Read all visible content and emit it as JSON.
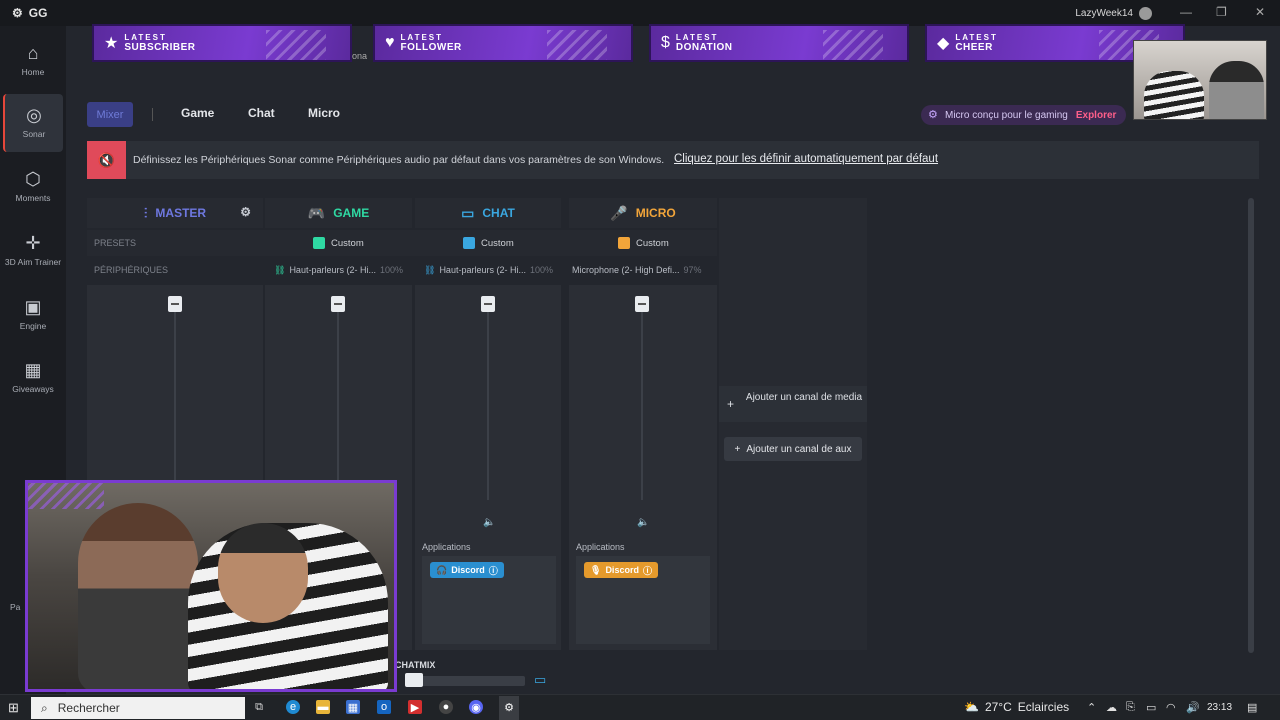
{
  "titlebar": {
    "brand": "GG",
    "username": "LazyWeek14"
  },
  "sidebar": {
    "items": [
      {
        "label": "Home",
        "icon": "home-icon",
        "glyph": "⌂"
      },
      {
        "label": "Sonar",
        "icon": "sonar-icon",
        "glyph": "◎"
      },
      {
        "label": "Moments",
        "icon": "moments-icon",
        "glyph": "⬡"
      },
      {
        "label": "3D Aim Trainer",
        "icon": "aim-icon",
        "glyph": "✛"
      },
      {
        "label": "Engine",
        "icon": "engine-icon",
        "glyph": "▣"
      },
      {
        "label": "Giveaways",
        "icon": "gift-icon",
        "glyph": "▦"
      }
    ],
    "partial_label": "Pa"
  },
  "alerts": [
    {
      "line1": "LATEST",
      "line2": "SUBSCRIBER",
      "glyph": "★"
    },
    {
      "line1": "LATEST",
      "line2": "FOLLOWER",
      "glyph": "♥"
    },
    {
      "line1": "LATEST",
      "line2": "DONATION",
      "glyph": "$"
    },
    {
      "line1": "LATEST",
      "line2": "CHEER",
      "glyph": "◆"
    }
  ],
  "hidden_label_fragment": "ona",
  "tabs": [
    {
      "label": "Mixer",
      "active": true
    },
    {
      "label": "Game"
    },
    {
      "label": "Chat"
    },
    {
      "label": "Micro"
    }
  ],
  "promo": {
    "text": "Micro conçu pour le gaming",
    "action": "Explorer"
  },
  "notice": {
    "text": "Définissez les Périphériques Sonar comme Périphériques audio par défaut dans vos paramètres de son Windows.",
    "link": "Cliquez pour les définir automatiquement par défaut"
  },
  "mixer": {
    "presets_label": "PRESETS",
    "devices_label": "PÉRIPHÉRIQUES",
    "columns": [
      {
        "title": "MASTER",
        "color": "#6e78e0",
        "glyph": "⫶"
      },
      {
        "title": "GAME",
        "color": "#2fd9a3",
        "glyph": "🎮",
        "preset": "Custom",
        "device": "Haut-parleurs (2- Hi...",
        "pct": "100%"
      },
      {
        "title": "CHAT",
        "color": "#3aa7e0",
        "glyph": "▭",
        "preset": "Custom",
        "device": "Haut-parleurs (2- Hi...",
        "pct": "100%"
      },
      {
        "title": "MICRO",
        "color": "#f2a53a",
        "glyph": "🎤",
        "preset": "Custom",
        "device": "Microphone (2- High Defi...",
        "pct": "97%"
      }
    ],
    "applications_label": "Applications",
    "chat_app": "Discord",
    "micro_app": "Discord",
    "add_media": "Ajouter un canal de media",
    "add_aux": "Ajouter un canal de aux",
    "chatmix_label": "CHATMIX"
  },
  "taskbar": {
    "search_placeholder": "Rechercher",
    "weather": "27°C",
    "weather_desc": "Eclaircies",
    "time": "23:13"
  }
}
